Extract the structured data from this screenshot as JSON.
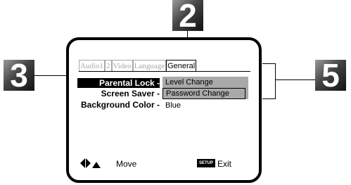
{
  "badges": {
    "step2": "2",
    "step3": "3",
    "step5": "5"
  },
  "tabs": [
    {
      "label": "Audio1",
      "active": false
    },
    {
      "label": "2",
      "active": false
    },
    {
      "label": "Video",
      "active": false
    },
    {
      "label": "Language",
      "active": false
    },
    {
      "label": "General",
      "active": true
    }
  ],
  "settings": {
    "parental_lock": {
      "label": "Parental Lock -"
    },
    "screen_saver": {
      "label": "Screen Saver -"
    },
    "background_color": {
      "label": "Background Color -",
      "value": "Blue"
    }
  },
  "dropdown": {
    "items": [
      "Level Change",
      "Password Change"
    ]
  },
  "footer": {
    "nav_icons": "left-right-up-arrows-icon",
    "move_label": "Move",
    "setup_key": "SETUP",
    "exit_label": "Exit"
  },
  "colors": {
    "highlight": "#000000",
    "dropdown_bg": "#a9a9a9",
    "inactive_tab": "#a8a8a8"
  }
}
